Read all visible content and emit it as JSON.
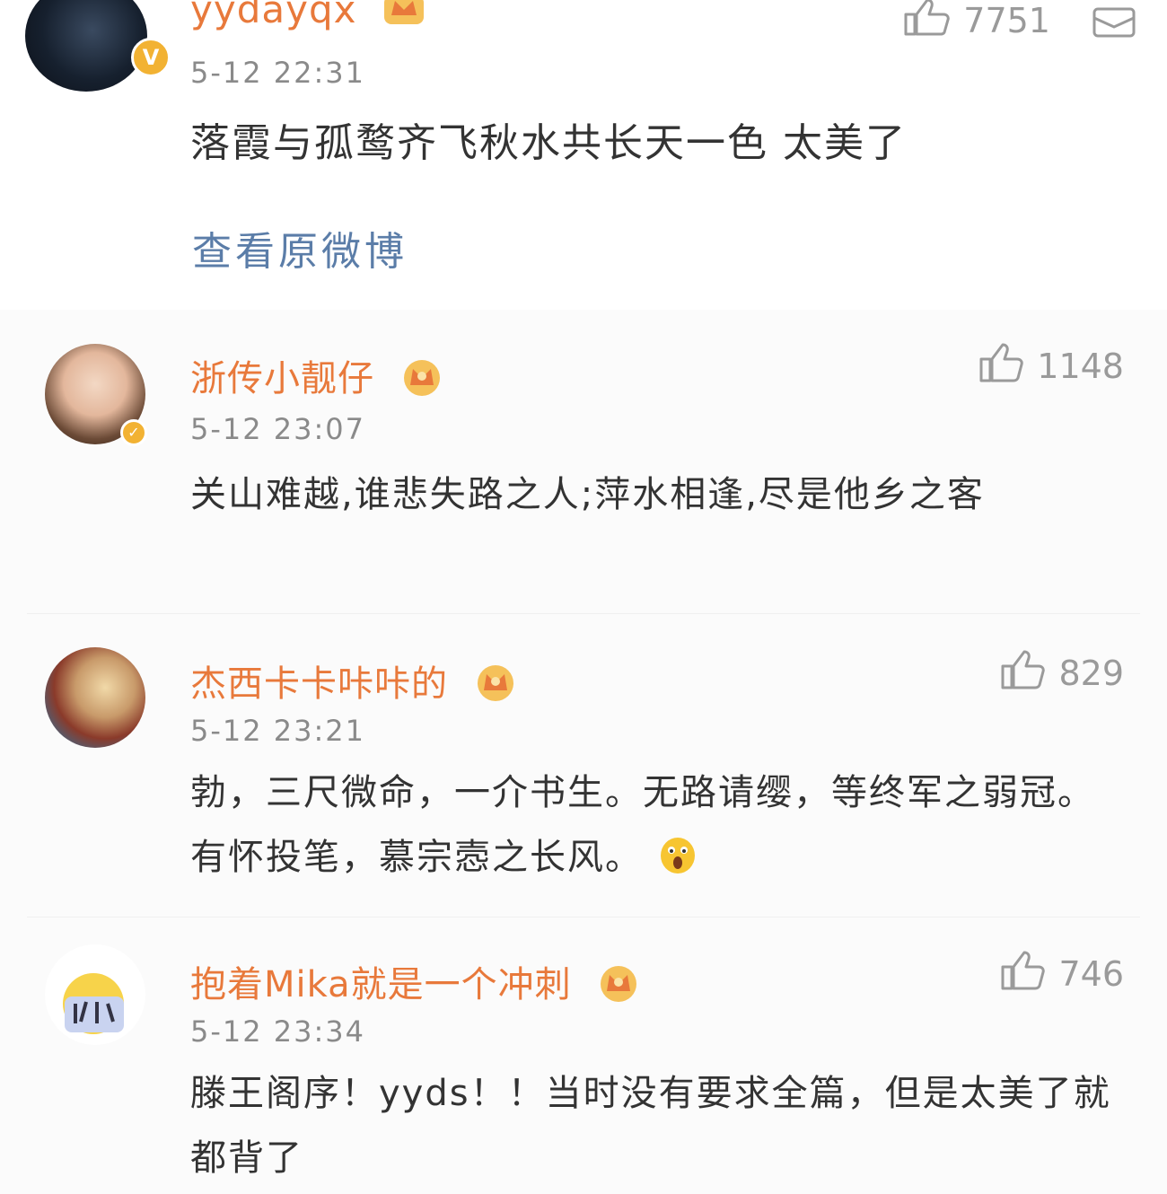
{
  "post": {
    "username": "yydayqx",
    "timestamp": "5-12 22:31",
    "like_count": "7751",
    "text": "落霞与孤鹜齐飞秋水共长天一色 太美了",
    "view_original_label": "查看原微博"
  },
  "comments": [
    {
      "username": "浙传小靓仔",
      "timestamp": "5-12 23:07",
      "like_count": "1148",
      "text": "关山难越,谁悲失路之人;萍水相逢,尽是他乡之客"
    },
    {
      "username": "杰西卡卡咔咔的",
      "timestamp": "5-12 23:21",
      "like_count": "829",
      "text": "勃，三尺微命，一介书生。无路请缨，等终军之弱冠。有怀投笔，慕宗悫之长风。"
    },
    {
      "username": "抱着Mika就是一个冲刺",
      "timestamp": "5-12 23:34",
      "like_count": "746",
      "text": "滕王阁序！yyds！！当时没有要求全篇，但是太美了就都背了"
    }
  ],
  "icons": {
    "like": "thumbs-up-icon",
    "share": "share-icon",
    "member": "crown-icon",
    "verified": "verified-v-icon",
    "emoji": "scared-face-emoji-icon"
  },
  "colors": {
    "username": "#e8793b",
    "link": "#5b7da8",
    "muted": "#9a9a9a",
    "badge": "#f2b233"
  }
}
